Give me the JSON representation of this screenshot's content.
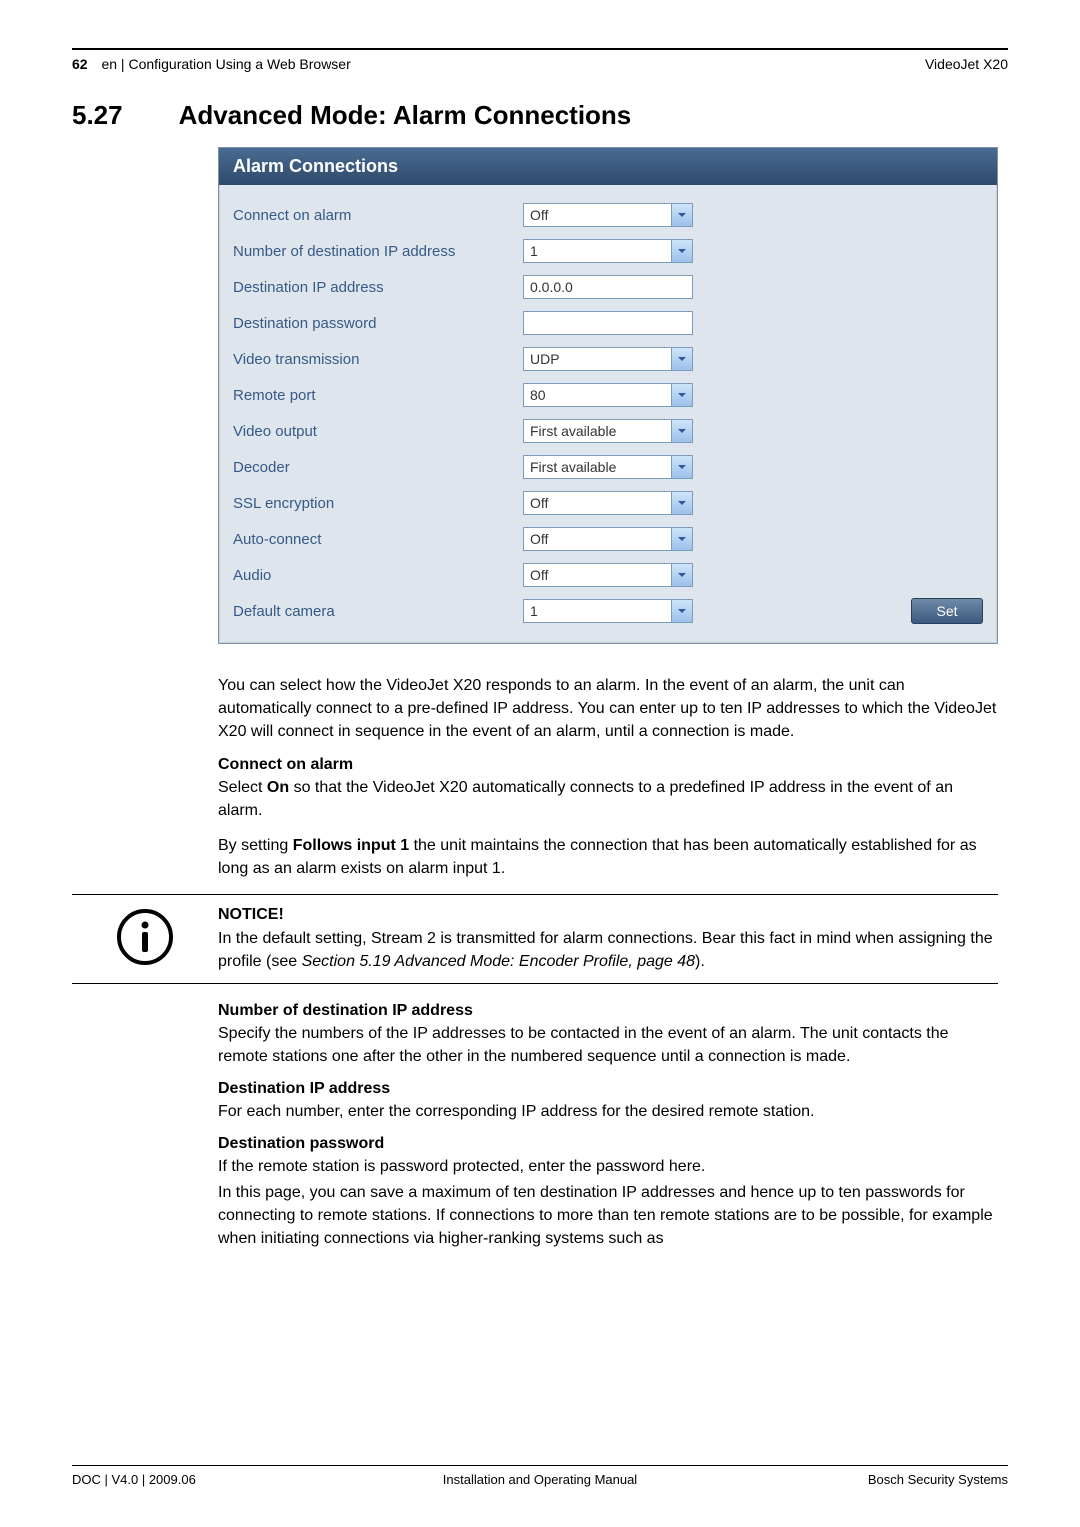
{
  "header": {
    "page_num": "62",
    "running_title": "en | Configuration Using a Web Browser",
    "product": "VideoJet X20"
  },
  "section": {
    "number": "5.27",
    "title": "Advanced Mode: Alarm Connections"
  },
  "panel": {
    "title": "Alarm Connections",
    "rows": [
      {
        "label": "Connect on alarm",
        "type": "select",
        "value": "Off"
      },
      {
        "label": "Number of destination IP address",
        "type": "select",
        "value": "1"
      },
      {
        "label": "Destination IP address",
        "type": "input",
        "value": "0.0.0.0"
      },
      {
        "label": "Destination password",
        "type": "input",
        "value": ""
      },
      {
        "label": "Video transmission",
        "type": "select",
        "value": "UDP"
      },
      {
        "label": "Remote port",
        "type": "select",
        "value": "80"
      },
      {
        "label": "Video output",
        "type": "select",
        "value": "First available"
      },
      {
        "label": "Decoder",
        "type": "select",
        "value": "First available"
      },
      {
        "label": "SSL encryption",
        "type": "select",
        "value": "Off"
      },
      {
        "label": "Auto-connect",
        "type": "select",
        "value": "Off"
      },
      {
        "label": "Audio",
        "type": "select",
        "value": "Off"
      },
      {
        "label": "Default camera",
        "type": "select",
        "value": "1",
        "has_set": true
      }
    ],
    "set_label": "Set"
  },
  "body": {
    "intro": "You can select how the VideoJet X20 responds to an alarm. In the event of an alarm, the unit can automatically connect to a pre-defined IP address. You can enter up to ten IP addresses to which the VideoJet X20 will connect in sequence in the event of an alarm, until a connection is made.",
    "connect_head": "Connect on alarm",
    "connect_p1_a": "Select ",
    "connect_p1_b": "On",
    "connect_p1_c": " so that the VideoJet X20 automatically connects to a predefined IP address in the event of an alarm.",
    "connect_p2_a": "By setting ",
    "connect_p2_b": "Follows input 1",
    "connect_p2_c": " the unit maintains the connection that has been automatically established for as long as an alarm exists on alarm input 1.",
    "notice_label": "NOTICE!",
    "notice_text_a": "In the default setting, Stream 2 is transmitted for alarm connections. Bear this fact in mind when assigning the profile (see ",
    "notice_text_b": "Section 5.19 Advanced Mode: Encoder Profile, page 48",
    "notice_text_c": ").",
    "numip_head": "Number of destination IP address",
    "numip_text": "Specify the numbers of the IP addresses to be contacted in the event of an alarm. The unit contacts the remote stations one after the other in the numbered sequence until a connection is made.",
    "destip_head": "Destination IP address",
    "destip_text": "For each number, enter the corresponding IP address for the desired remote station.",
    "destpw_head": "Destination password",
    "destpw_p1": "If the remote station is password protected, enter the password here.",
    "destpw_p2": "In this page, you can save a maximum of ten destination IP addresses and hence up to ten passwords for connecting to remote stations. If connections to more than ten remote stations are to be possible, for example when initiating connections via higher-ranking systems such as"
  },
  "footer": {
    "left": "DOC | V4.0 | 2009.06",
    "center": "Installation and Operating Manual",
    "right": "Bosch Security Systems"
  }
}
